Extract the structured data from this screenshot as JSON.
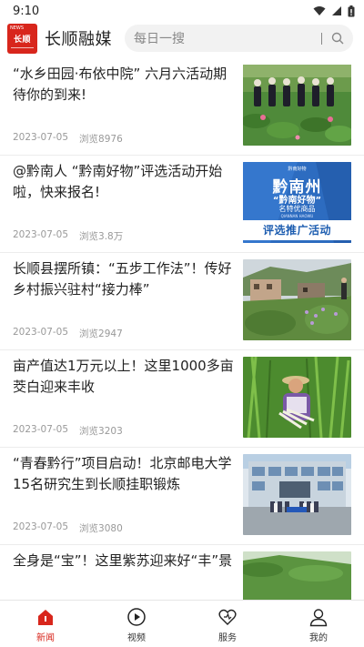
{
  "status_bar": {
    "time": "9:10"
  },
  "header": {
    "logo_news": "NEWS",
    "logo_text": "长顺",
    "app_name": "长顺融媒",
    "search_placeholder": "每日一搜"
  },
  "news": [
    {
      "title": "“水乡田园·布依中院” 六月六活动期待你的到来!",
      "date": "2023-07-05",
      "views": "浏览8976"
    },
    {
      "title": "@黔南人 “黔南好物”评选活动开始啦，快来报名!",
      "date": "2023-07-05",
      "views": "浏览3.8万",
      "thumb_text": {
        "small": "黔南好物",
        "big": "黔南州",
        "quote": "“黔南好物”",
        "sub": "名特优商品",
        "pinyin": "QIANNAN HAOWU",
        "bottom": "评选推广活动"
      }
    },
    {
      "title": "长顺县摆所镇：“五步工作法”！传好乡村振兴驻村“接力棒”",
      "date": "2023-07-05",
      "views": "浏览2947"
    },
    {
      "title": "亩产值达1万元以上！这里1000多亩茭白迎来丰收",
      "date": "2023-07-05",
      "views": "浏览3203"
    },
    {
      "title": "“青春黔行”项目启动！北京邮电大学15名研究生到长顺挂职锻炼",
      "date": "2023-07-05",
      "views": "浏览3080"
    },
    {
      "title": "全身是“宝”！这里紫苏迎来好“丰”景",
      "date": "",
      "views": ""
    }
  ],
  "tabs": [
    {
      "label": "新闻",
      "icon": "home-icon",
      "active": true
    },
    {
      "label": "视频",
      "icon": "play-icon",
      "active": false
    },
    {
      "label": "服务",
      "icon": "heart-icon",
      "active": false
    },
    {
      "label": "我的",
      "icon": "user-icon",
      "active": false
    }
  ],
  "colors": {
    "accent": "#d8261c",
    "text": "#222222",
    "meta": "#999999"
  }
}
